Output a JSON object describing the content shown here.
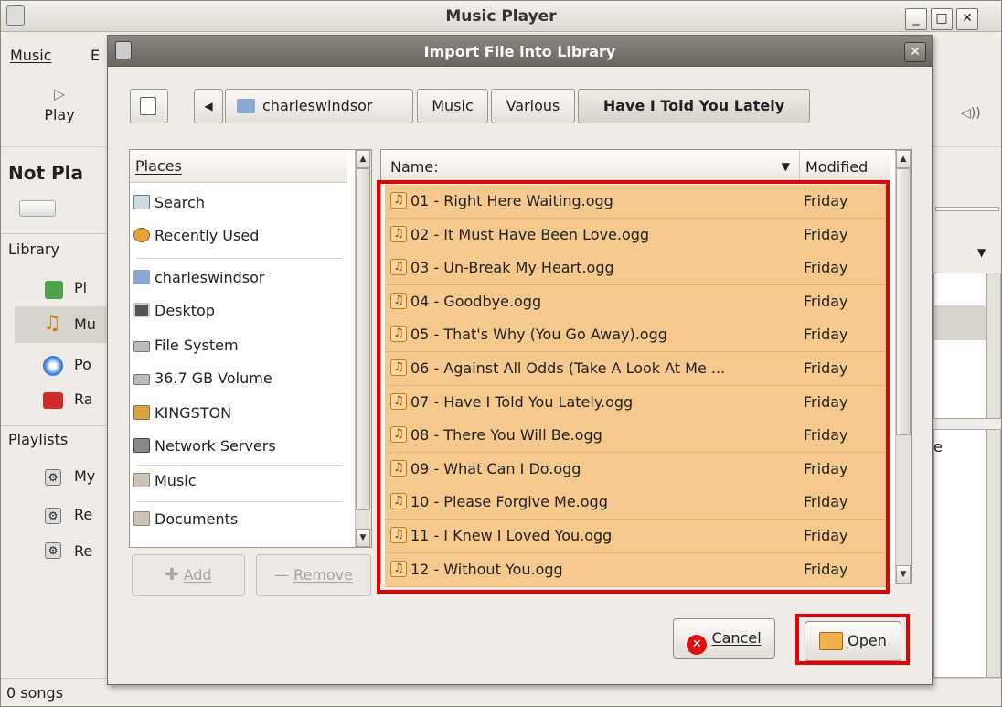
{
  "main_window": {
    "title": "Music Player",
    "menu": [
      "Music",
      "E"
    ],
    "toolbar": {
      "play_label": "Play",
      "now_playing": "Not Pla"
    },
    "library_header": "Library",
    "library_items": [
      "Pl",
      "Mu",
      "Po",
      "Ra"
    ],
    "playlists_header": "Playlists",
    "playlist_items": [
      "My",
      "Re",
      "Re"
    ],
    "right_partial": "e",
    "status": "0 songs"
  },
  "dialog": {
    "title": "Import File into Library",
    "path_buttons": [
      "charleswindsor",
      "Music",
      "Various",
      "Have I Told You Lately"
    ],
    "places_header": "Places",
    "places": [
      "Search",
      "Recently Used",
      "charleswindsor",
      "Desktop",
      "File System",
      "36.7 GB Volume",
      "KINGSTON",
      "Network Servers",
      "Music",
      "Documents"
    ],
    "add_label": "Add",
    "remove_label": "Remove",
    "files_header": {
      "name": "Name:",
      "modified": "Modified"
    },
    "files": [
      {
        "name": "01 - Right Here Waiting.ogg",
        "modified": "Friday"
      },
      {
        "name": "02 - It Must Have Been Love.ogg",
        "modified": "Friday"
      },
      {
        "name": "03 - Un-Break My Heart.ogg",
        "modified": "Friday"
      },
      {
        "name": "04 - Goodbye.ogg",
        "modified": "Friday"
      },
      {
        "name": "05 - That's Why (You Go Away).ogg",
        "modified": "Friday"
      },
      {
        "name": "06 - Against All Odds (Take A Look At Me ...",
        "modified": "Friday"
      },
      {
        "name": "07 - Have I Told You Lately.ogg",
        "modified": "Friday"
      },
      {
        "name": "08 - There You Will Be.ogg",
        "modified": "Friday"
      },
      {
        "name": "09 - What Can I Do.ogg",
        "modified": "Friday"
      },
      {
        "name": "10 - Please Forgive Me.ogg",
        "modified": "Friday"
      },
      {
        "name": "11 - I Knew I Loved You.ogg",
        "modified": "Friday"
      },
      {
        "name": "12 - Without You.ogg",
        "modified": "Friday"
      }
    ],
    "cancel_label": "Cancel",
    "open_label": "Open"
  },
  "colors": {
    "selection": "#f5c98e",
    "highlight_box": "#e60000"
  }
}
